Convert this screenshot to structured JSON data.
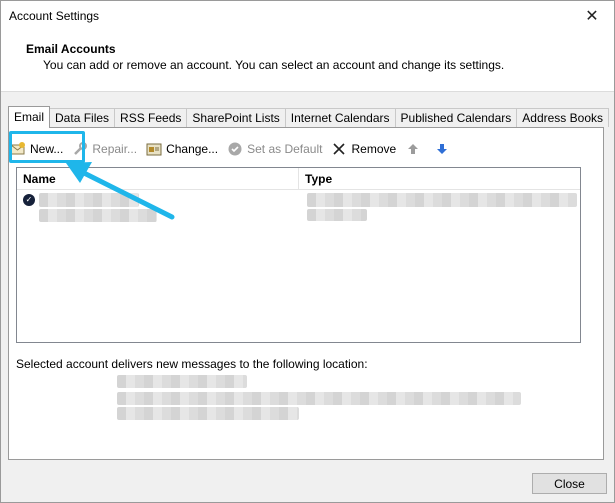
{
  "window": {
    "title": "Account Settings",
    "close_glyph": "✕"
  },
  "header": {
    "title": "Email Accounts",
    "subtitle": "You can add or remove an account. You can select an account and change its settings."
  },
  "tabs": [
    {
      "label": "Email",
      "active": true
    },
    {
      "label": "Data Files"
    },
    {
      "label": "RSS Feeds"
    },
    {
      "label": "SharePoint Lists"
    },
    {
      "label": "Internet Calendars"
    },
    {
      "label": "Published Calendars"
    },
    {
      "label": "Address Books"
    }
  ],
  "toolbar": {
    "new_label": "New...",
    "repair_label": "Repair...",
    "change_label": "Change...",
    "default_label": "Set as Default",
    "remove_label": "Remove"
  },
  "list": {
    "col_name": "Name",
    "col_type": "Type"
  },
  "location_note": "Selected account delivers new messages to the following location:",
  "buttons": {
    "close": "Close"
  },
  "colors": {
    "highlight": "#1fb6ea",
    "up_arrow": "#9c9c9c",
    "down_arrow": "#2f6fd6"
  }
}
